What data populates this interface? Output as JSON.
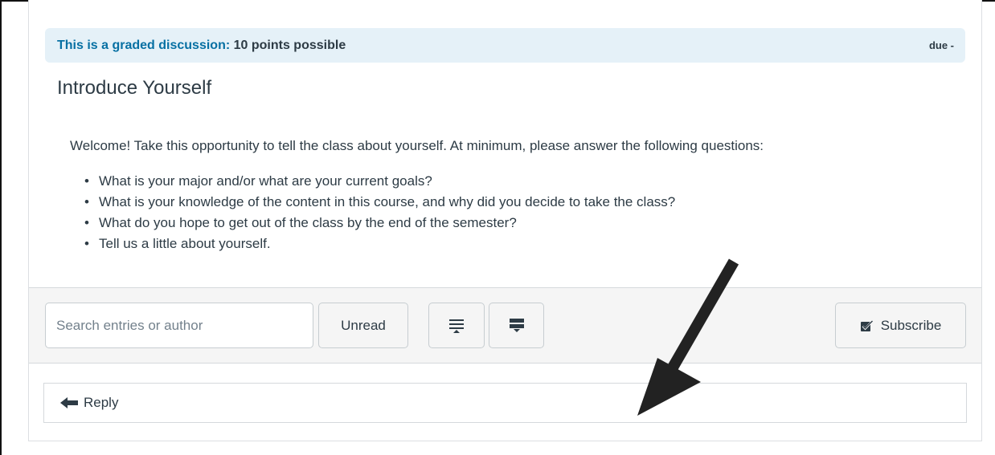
{
  "banner": {
    "prefix": "This is a graded discussion:",
    "points": "10 points possible",
    "due": "due -"
  },
  "topic": {
    "title": "Introduce Yourself",
    "intro": "Welcome! Take this opportunity to tell the class about yourself. At minimum, please answer the following questions:",
    "questions": [
      "What is your major and/or what are your current goals?",
      "What is your knowledge of the content in this course, and why did you decide to take the class?",
      "What do you hope to get out of the class by the end of the semester?",
      "Tell us a little about yourself."
    ]
  },
  "toolbar": {
    "search_placeholder": "Search entries or author",
    "unread_label": "Unread",
    "expand_icon": "expand-all-icon",
    "collapse_icon": "collapse-all-icon",
    "subscribe_label": "Subscribe",
    "subscribe_icon": "checkbox-checked-icon"
  },
  "reply": {
    "label": "Reply",
    "icon": "reply-arrow-icon"
  },
  "annotation": {
    "icon": "pointer-arrow-icon",
    "color": "#222222"
  },
  "colors": {
    "banner_bg": "#e5f1f8",
    "banner_link": "#0770a3",
    "toolbar_bg": "#f5f5f5",
    "text": "#2d3b45"
  }
}
